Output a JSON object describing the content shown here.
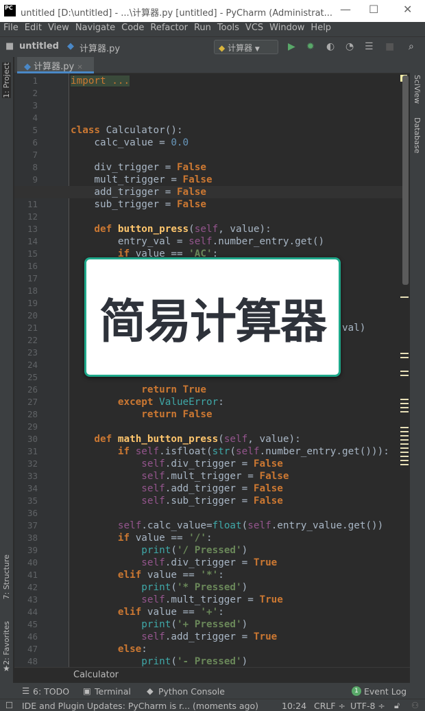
{
  "window": {
    "title": "untitled [D:\\untitled] - ...\\计算器.py [untitled] - PyCharm (Administrat...",
    "logo": "PC"
  },
  "menu": [
    "File",
    "Edit",
    "View",
    "Navigate",
    "Code",
    "Refactor",
    "Run",
    "Tools",
    "VCS",
    "Window",
    "Help"
  ],
  "nav": {
    "project": "untitled",
    "file": "计算器.py",
    "run_config": "计算器"
  },
  "left_tools": {
    "project": "1: Project",
    "structure": "7: Structure",
    "favorites": "2: Favorites"
  },
  "right_tools": {
    "sciview": "SciView",
    "database": "Database"
  },
  "tab": {
    "label": "计算器.py"
  },
  "overlay": {
    "title": "简易计算器"
  },
  "breadcrumb": "Calculator",
  "current_line": 10,
  "code": [
    [
      [
        "import ...",
        "fold"
      ]
    ],
    [],
    [],
    [],
    [
      [
        "class ",
        "kw"
      ],
      [
        "Calculator():",
        ""
      ]
    ],
    [
      [
        "    calc_value = ",
        ""
      ],
      [
        "0.0",
        "num"
      ]
    ],
    [],
    [
      [
        "    div_trigger = ",
        ""
      ],
      [
        "False",
        "kw"
      ]
    ],
    [
      [
        "    mult_trigger = ",
        ""
      ],
      [
        "False",
        "kw"
      ]
    ],
    [
      [
        "    add_trigger = ",
        ""
      ],
      [
        "False",
        "kw"
      ]
    ],
    [
      [
        "    sub_trigger = ",
        ""
      ],
      [
        "False",
        "kw"
      ]
    ],
    [],
    [
      [
        "    def ",
        "kw"
      ],
      [
        "button_press",
        "fn"
      ],
      [
        "(",
        ""
      ],
      [
        "self",
        "self"
      ],
      [
        ", value):",
        ""
      ]
    ],
    [
      [
        "        entry_val = ",
        ""
      ],
      [
        "self",
        "self"
      ],
      [
        ".number_entry.get()",
        ""
      ]
    ],
    [
      [
        "        if ",
        "kw"
      ],
      [
        "value == ",
        ""
      ],
      [
        "'AC'",
        "str"
      ],
      [
        ":",
        ""
      ]
    ],
    [],
    [],
    [],
    [],
    [],
    [
      [
        "                                              val)",
        ""
      ]
    ],
    [],
    [],
    [],
    [],
    [
      [
        "            return True",
        "kw"
      ]
    ],
    [
      [
        "        except ",
        "kw"
      ],
      [
        "ValueError",
        "bi"
      ],
      [
        ":",
        ""
      ]
    ],
    [
      [
        "            return False",
        "kw"
      ]
    ],
    [],
    [
      [
        "    def ",
        "kw"
      ],
      [
        "math_button_press",
        "fn"
      ],
      [
        "(",
        ""
      ],
      [
        "self",
        "self"
      ],
      [
        ", value):",
        ""
      ]
    ],
    [
      [
        "        if ",
        "kw"
      ],
      [
        "self",
        "self"
      ],
      [
        ".isfloat(",
        ""
      ],
      [
        "str",
        "bi"
      ],
      [
        "(",
        ""
      ],
      [
        "self",
        "self"
      ],
      [
        ".number_entry.get())):",
        ""
      ]
    ],
    [
      [
        "            ",
        ""
      ],
      [
        "self",
        "self"
      ],
      [
        ".div_trigger = ",
        ""
      ],
      [
        "False",
        "kw"
      ]
    ],
    [
      [
        "            ",
        ""
      ],
      [
        "self",
        "self"
      ],
      [
        ".mult_trigger = ",
        ""
      ],
      [
        "False",
        "kw"
      ]
    ],
    [
      [
        "            ",
        ""
      ],
      [
        "self",
        "self"
      ],
      [
        ".add_trigger = ",
        ""
      ],
      [
        "False",
        "kw"
      ]
    ],
    [
      [
        "            ",
        ""
      ],
      [
        "self",
        "self"
      ],
      [
        ".sub_trigger = ",
        ""
      ],
      [
        "False",
        "kw"
      ]
    ],
    [],
    [
      [
        "        ",
        ""
      ],
      [
        "self",
        "self"
      ],
      [
        ".calc_value=",
        ""
      ],
      [
        "float",
        "bi"
      ],
      [
        "(",
        ""
      ],
      [
        "self",
        "self"
      ],
      [
        ".entry_value.get())",
        ""
      ]
    ],
    [
      [
        "        if ",
        "kw"
      ],
      [
        "value == ",
        ""
      ],
      [
        "'/'",
        "str"
      ],
      [
        ":",
        ""
      ]
    ],
    [
      [
        "            ",
        ""
      ],
      [
        "print",
        "bi"
      ],
      [
        "(",
        ""
      ],
      [
        "'/ Pressed'",
        "str"
      ],
      [
        ")",
        ""
      ]
    ],
    [
      [
        "            ",
        ""
      ],
      [
        "self",
        "self"
      ],
      [
        ".div_trigger = ",
        ""
      ],
      [
        "True",
        "kw"
      ]
    ],
    [
      [
        "        elif ",
        "kw"
      ],
      [
        "value == ",
        ""
      ],
      [
        "'*'",
        "str"
      ],
      [
        ":",
        ""
      ]
    ],
    [
      [
        "            ",
        ""
      ],
      [
        "print",
        "bi"
      ],
      [
        "(",
        ""
      ],
      [
        "'* Pressed'",
        "str"
      ],
      [
        ")",
        ""
      ]
    ],
    [
      [
        "            ",
        ""
      ],
      [
        "self",
        "self"
      ],
      [
        ".mult_trigger = ",
        ""
      ],
      [
        "True",
        "kw"
      ]
    ],
    [
      [
        "        elif ",
        "kw"
      ],
      [
        "value == ",
        ""
      ],
      [
        "'+'",
        "str"
      ],
      [
        ":",
        ""
      ]
    ],
    [
      [
        "            ",
        ""
      ],
      [
        "print",
        "bi"
      ],
      [
        "(",
        ""
      ],
      [
        "'+ Pressed'",
        "str"
      ],
      [
        ")",
        ""
      ]
    ],
    [
      [
        "            ",
        ""
      ],
      [
        "self",
        "self"
      ],
      [
        ".add_trigger = ",
        ""
      ],
      [
        "True",
        "kw"
      ]
    ],
    [
      [
        "        else",
        "kw"
      ],
      [
        ":",
        ""
      ]
    ],
    [
      [
        "            ",
        ""
      ],
      [
        "print",
        "bi"
      ],
      [
        "(",
        ""
      ],
      [
        "'- Pressed'",
        "str"
      ],
      [
        ")",
        ""
      ]
    ],
    [
      [
        "            ",
        ""
      ],
      [
        "self",
        "self"
      ],
      [
        ".sub_trigger = ",
        ""
      ],
      [
        "True",
        "kw"
      ]
    ]
  ],
  "toolwindows": {
    "todo": "6: TODO",
    "terminal": "Terminal",
    "console": "Python Console",
    "event_log": "Event Log",
    "event_count": "1"
  },
  "status": {
    "message": "IDE and Plugin Updates: PyCharm is r... (moments ago)",
    "position": "10:24",
    "line_sep": "CRLF ÷",
    "encoding": "UTF-8 ÷"
  },
  "colors": {
    "accent": "#1ea88a",
    "run": "#59a869"
  }
}
